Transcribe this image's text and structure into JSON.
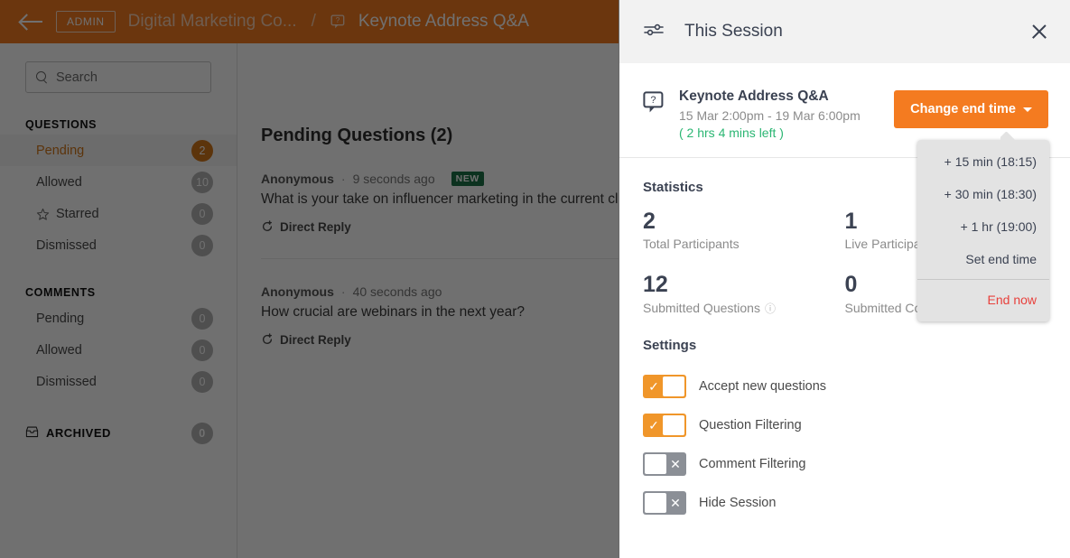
{
  "topbar": {
    "back_icon": "back-arrow-icon",
    "admin_label": "ADMIN",
    "breadcrumb_parent": "Digital Marketing Co...",
    "breadcrumb_separator": "/",
    "breadcrumb_icon": "question-bubble-icon",
    "breadcrumb_current": "Keynote Address Q&A"
  },
  "sidebar": {
    "search": {
      "placeholder": "Search",
      "value": "",
      "icon": "search-icon"
    },
    "questions_heading": "QUESTIONS",
    "questions_items": [
      {
        "label": "Pending",
        "count": "2",
        "active": true,
        "sub": false
      },
      {
        "label": "Allowed",
        "count": "10",
        "active": false,
        "sub": false
      },
      {
        "label": "Starred",
        "count": "0",
        "active": false,
        "sub": true
      },
      {
        "label": "Dismissed",
        "count": "0",
        "active": false,
        "sub": false
      }
    ],
    "comments_heading": "COMMENTS",
    "comments_items": [
      {
        "label": "Pending",
        "count": "0"
      },
      {
        "label": "Allowed",
        "count": "0"
      },
      {
        "label": "Dismissed",
        "count": "0"
      }
    ],
    "archived": {
      "label": "ARCHIVED",
      "count": "0",
      "icon": "archive-box-icon"
    }
  },
  "main": {
    "title": "Pending Questions (2)",
    "questions": [
      {
        "author": "Anonymous",
        "separator": "·",
        "time": "9 seconds ago",
        "tag": "NEW",
        "text": "What is your take on influencer marketing in the current climate?",
        "reply_label": "Direct Reply"
      },
      {
        "author": "Anonymous",
        "separator": "·",
        "time": "40 seconds ago",
        "tag": "",
        "text": "How crucial are webinars in the next year?",
        "reply_label": "Direct Reply"
      }
    ]
  },
  "panel": {
    "header": {
      "icon": "sliders-icon",
      "title": "This Session",
      "close_icon": "close-icon"
    },
    "session": {
      "icon": "question-bubble-icon",
      "name": "Keynote Address Q&A",
      "dates": "15 Mar 2:00pm - 19 Mar 6:00pm",
      "time_left": "( 2 hrs 4 mins left )",
      "change_end_time_label": "Change end time"
    },
    "statistics": {
      "heading": "Statistics",
      "items": [
        {
          "value": "2",
          "label": "Total Participants",
          "info": false
        },
        {
          "value": "1",
          "label": "Live Participants",
          "info": false
        },
        {
          "value": "12",
          "label": "Submitted Questions",
          "info": true
        },
        {
          "value": "0",
          "label": "Submitted Comments",
          "info": true
        }
      ]
    },
    "settings": {
      "heading": "Settings",
      "items": [
        {
          "label": "Accept new questions",
          "state": "on"
        },
        {
          "label": "Question Filtering",
          "state": "on"
        },
        {
          "label": "Comment Filtering",
          "state": "off"
        },
        {
          "label": "Hide Session",
          "state": "off"
        }
      ]
    },
    "dropdown": {
      "items": [
        {
          "label": "+ 15 min (18:15)",
          "danger": false
        },
        {
          "label": "+ 30 min (18:30)",
          "danger": false
        },
        {
          "label": "+ 1 hr (19:00)",
          "danger": false
        },
        {
          "label": "Set end time",
          "danger": false
        },
        {
          "label": "End now",
          "danger": true
        }
      ]
    }
  },
  "colors": {
    "brand_orange": "#f47b20",
    "toggle_on": "#f0962a",
    "toggle_off": "#8b8f96",
    "green_tag": "#1d7348",
    "time_left_green": "#2bb673",
    "danger_red": "#e8413c"
  }
}
